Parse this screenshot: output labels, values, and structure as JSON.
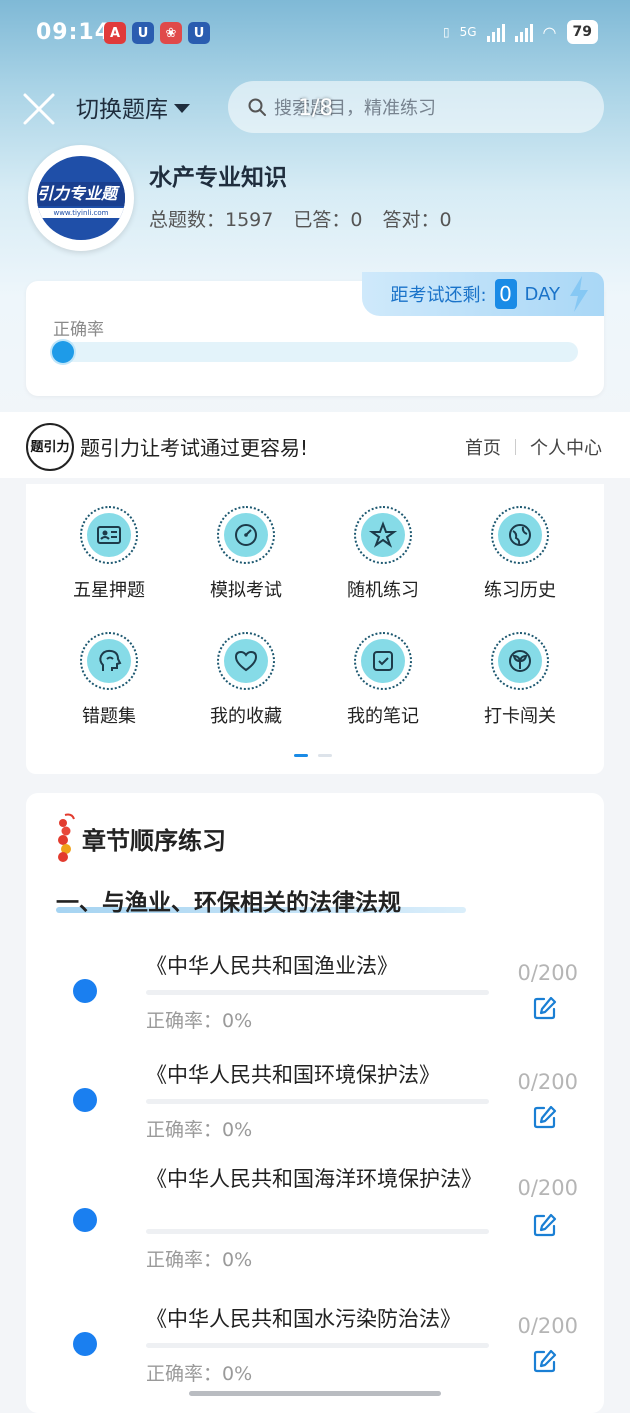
{
  "status_bar": {
    "time": "09:14",
    "app_icons": [
      {
        "name": "lottery-app-icon",
        "glyph": "A",
        "color": "#e03b3b"
      },
      {
        "name": "blue-shield-app-icon",
        "glyph": "U",
        "color": "#2a5db0"
      },
      {
        "name": "red-app-icon",
        "glyph": "❀",
        "color": "#e04a4a"
      },
      {
        "name": "blue-shield-app-icon-2",
        "glyph": "U",
        "color": "#2a5db0"
      }
    ],
    "network": "5G",
    "battery": "79"
  },
  "header": {
    "switch_label": "切换题库",
    "search_placeholder": "搜索题目，精准练习",
    "pager": "1/8"
  },
  "bank": {
    "logo_text": "引力专业题",
    "logo_url": "www.tiyinli.com",
    "title": "水产专业知识",
    "total_label": "总题数：1597",
    "answered_label": "已答：0",
    "correct_label": "答对：0"
  },
  "accuracy": {
    "exam_label": "距考试还剩:",
    "days": "0",
    "days_unit": "DAY",
    "label": "正确率",
    "rate": 0
  },
  "slogan": {
    "logo_text": "题引力",
    "text": "题引力让考试通过更容易!",
    "nav": [
      "首页",
      "个人中心"
    ]
  },
  "grid": [
    {
      "label": "五星押题",
      "icon": "id-card-icon"
    },
    {
      "label": "模拟考试",
      "icon": "speedometer-icon"
    },
    {
      "label": "随机练习",
      "icon": "shuffle-star-icon"
    },
    {
      "label": "练习历史",
      "icon": "globe-icon"
    },
    {
      "label": "错题集",
      "icon": "head-profile-icon"
    },
    {
      "label": "我的收藏",
      "icon": "heart-icon"
    },
    {
      "label": "我的笔记",
      "icon": "note-check-icon"
    },
    {
      "label": "打卡闯关",
      "icon": "sprout-icon"
    }
  ],
  "chapters": {
    "heading": "章节顺序练习",
    "section": "一、与渔业、环保相关的法律法规",
    "items": [
      {
        "title": "《中华人民共和国渔业法》",
        "accuracy": "正确率：0%",
        "count": "0/200"
      },
      {
        "title": "《中华人民共和国环境保护法》",
        "accuracy": "正确率：0%",
        "count": "0/200"
      },
      {
        "title": "《中华人民共和国海洋环境保护法》",
        "accuracy": "正确率：0%",
        "count": "0/200"
      },
      {
        "title": "《中华人民共和国水污染防治法》",
        "accuracy": "正确率：0%",
        "count": "0/200"
      }
    ]
  }
}
